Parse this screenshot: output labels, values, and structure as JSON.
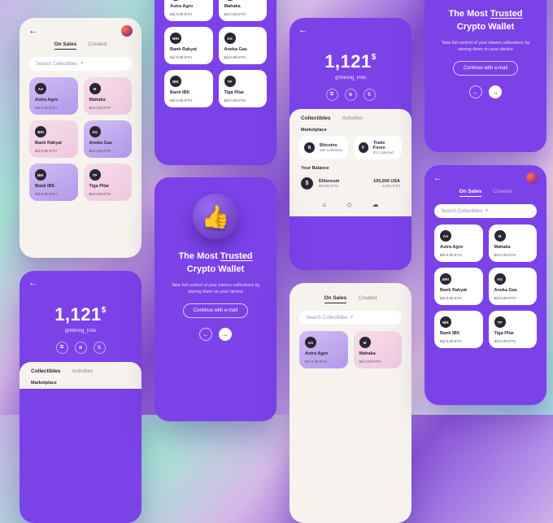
{
  "nav": {
    "back": "←",
    "next": "→"
  },
  "tabs": {
    "onSales": "On Sales",
    "created": "Created"
  },
  "search": {
    "placeholder": "Search Collectibles"
  },
  "tiles": [
    {
      "badge": "AA",
      "name": "Astra Agro",
      "bid": "Bid 0,90 ETH"
    },
    {
      "badge": "M",
      "name": "Mahaka",
      "bid": "Bid 0,90 ETH"
    },
    {
      "badge": "BRI",
      "name": "Bank Rakyat",
      "bid": "Bid 0,90 ETH"
    },
    {
      "badge": "AG",
      "name": "Aneka Gas",
      "bid": "Bid 0,90 ETH"
    },
    {
      "badge": "IBK",
      "name": "Bank IBK",
      "bid": "Bid 0,90 ETH"
    },
    {
      "badge": "TP",
      "name": "Tiga Pilar",
      "bid": "Bid 0,90 ETH"
    }
  ],
  "wallet": {
    "balance": "1,121",
    "currency": "$",
    "handle": "@Mining_Indo",
    "tabs": {
      "collectibles": "Collectibles",
      "activities": "Activities"
    },
    "marketplaceLabel": "Marketplace",
    "marketplace": [
      {
        "badge": "B",
        "name": "Bitcoins",
        "sub": "156 Collected"
      },
      {
        "badge": "F",
        "name": "Trade Forex",
        "sub": "93 Collected"
      }
    ],
    "yourBalanceLabel": "Your Balance",
    "asset": {
      "badge": "$",
      "name": "Ethereum",
      "sub": "96,001 ETH",
      "fiat": "105,000 USA",
      "fiatSub": "6,001 ETH"
    }
  },
  "onboard": {
    "title1": "The Most ",
    "titleU": "Trusted",
    "title2": "Crypto Wallet",
    "sub": "Take full control of your tokens collections by storing them on your device",
    "cta": "Continue with e-mail"
  }
}
